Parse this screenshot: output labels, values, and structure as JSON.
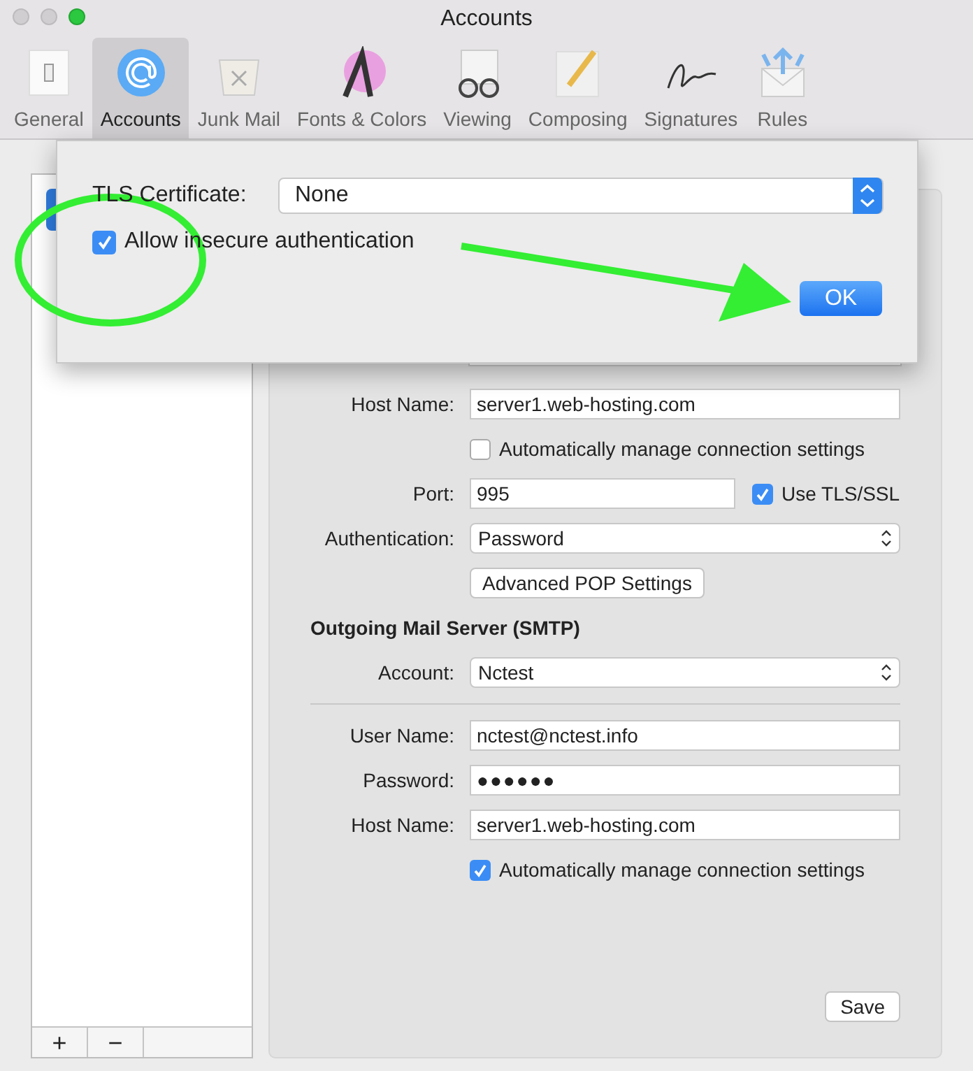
{
  "window": {
    "title": "Accounts"
  },
  "toolbar": [
    {
      "label": "General",
      "selected": false
    },
    {
      "label": "Accounts",
      "selected": true
    },
    {
      "label": "Junk Mail",
      "selected": false
    },
    {
      "label": "Fonts & Colors",
      "selected": false
    },
    {
      "label": "Viewing",
      "selected": false
    },
    {
      "label": "Composing",
      "selected": false
    },
    {
      "label": "Signatures",
      "selected": false
    },
    {
      "label": "Rules",
      "selected": false
    }
  ],
  "sidebar": {
    "buttons": [
      "+",
      "−"
    ]
  },
  "settings": [
    {
      "kind": "field",
      "label": "Host Name:",
      "value": "server1.web-hosting.com"
    },
    {
      "kind": "checkbox",
      "label": "Automatically manage connection settings",
      "checked": false
    },
    {
      "kind": "port",
      "label": "Port:",
      "value": "995",
      "option": "Use TLS/SSL",
      "checked": true
    },
    {
      "kind": "popup",
      "label": "Authentication:",
      "value": "Password"
    },
    {
      "kind": "button",
      "label": "Advanced POP Settings"
    },
    {
      "kind": "heading",
      "label": "Outgoing Mail Server (SMTP)"
    },
    {
      "kind": "popup",
      "label": "Account:",
      "value": "Nctest"
    },
    {
      "kind": "divider"
    },
    {
      "kind": "field",
      "label": "User Name:",
      "value": "nctest@nctest.info"
    },
    {
      "kind": "password",
      "label": "Password:",
      "value": "●●●●●●"
    },
    {
      "kind": "field",
      "label": "Host Name:",
      "value": "server1.web-hosting.com"
    },
    {
      "kind": "checkbox",
      "label": "Automatically manage connection settings",
      "checked": true
    }
  ],
  "save_button": "Save",
  "sheet": {
    "tls_label": "TLS Certificate:",
    "tls_value": "None",
    "allow_insecure": {
      "label": "Allow insecure authentication",
      "checked": true
    },
    "ok_button": "OK"
  }
}
